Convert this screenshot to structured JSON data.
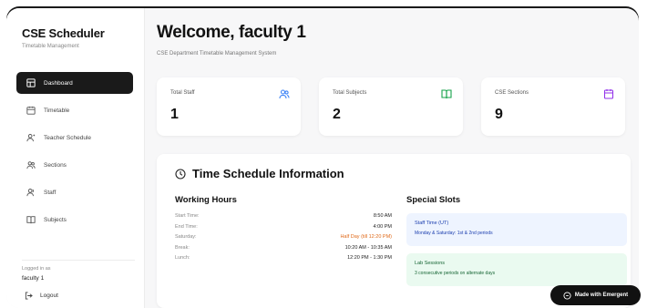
{
  "app": {
    "title": "CSE Scheduler",
    "subtitle": "Timetable Management"
  },
  "sidebar": {
    "items": [
      {
        "label": "Dashboard",
        "icon": "grid-icon",
        "active": true
      },
      {
        "label": "Timetable",
        "icon": "calendar-icon",
        "active": false
      },
      {
        "label": "Teacher Schedule",
        "icon": "user-icon",
        "active": false
      },
      {
        "label": "Sections",
        "icon": "users-icon",
        "active": false
      },
      {
        "label": "Staff",
        "icon": "user-group-icon",
        "active": false
      },
      {
        "label": "Subjects",
        "icon": "book-icon",
        "active": false
      }
    ],
    "user_label": "Logged in as",
    "user_name": "faculty 1",
    "logout_label": "Logout"
  },
  "header": {
    "welcome": "Welcome, faculty 1",
    "subtitle": "CSE Department Timetable Management System"
  },
  "stats": [
    {
      "label": "Total Staff",
      "value": "1",
      "icon": "users-icon",
      "color": "#3b82f6"
    },
    {
      "label": "Total Subjects",
      "value": "2",
      "icon": "book-icon",
      "color": "#16a34a"
    },
    {
      "label": "CSE Sections",
      "value": "9",
      "icon": "calendar-icon",
      "color": "#9333ea"
    }
  ],
  "schedule": {
    "title": "Time Schedule Information",
    "working_hours_title": "Working Hours",
    "working_hours": [
      {
        "key": "Start Time:",
        "value": "8:50 AM",
        "warn": false
      },
      {
        "key": "End Time:",
        "value": "4:00 PM",
        "warn": false
      },
      {
        "key": "Saturday:",
        "value": "Half Day (till 12:20 PM)",
        "warn": true
      },
      {
        "key": "Break:",
        "value": "10:20 AM - 10:35 AM",
        "warn": false
      },
      {
        "key": "Lunch:",
        "value": "12:20 PM - 1:30 PM",
        "warn": false
      }
    ],
    "special_slots_title": "Special Slots",
    "special_slots": [
      {
        "title": "Staff Time (UT)",
        "desc": "Monday & Saturday: 1st & 2nd periods",
        "bg": "#eef4ff",
        "fg": "#1e40af"
      },
      {
        "title": "Lab Sessions",
        "desc": "3 consecutive periods on alternate days",
        "bg": "#eafaf0",
        "fg": "#166534"
      }
    ]
  },
  "badge": {
    "label": "Made with Emergent"
  }
}
